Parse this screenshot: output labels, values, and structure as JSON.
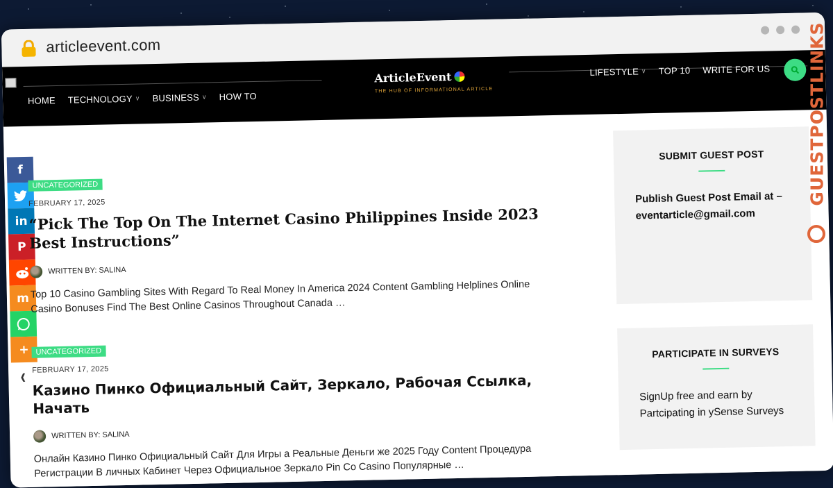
{
  "browser": {
    "url": "articleevent.com"
  },
  "header": {
    "nav_left": [
      {
        "label": "HOME",
        "dropdown": false
      },
      {
        "label": "TECHNOLOGY",
        "dropdown": true
      },
      {
        "label": "BUSINESS",
        "dropdown": true
      },
      {
        "label": "HOW TO",
        "dropdown": false
      }
    ],
    "logo": {
      "title": "ArticleEvent",
      "tagline": "THE HUB OF INFORMATIONAL ARTICLE"
    },
    "nav_right": [
      {
        "label": "LIFESTYLE",
        "dropdown": true
      },
      {
        "label": "TOP 10",
        "dropdown": false
      },
      {
        "label": "WRITE FOR US",
        "dropdown": false
      }
    ]
  },
  "social_share": [
    "facebook-icon",
    "twitter-icon",
    "linkedin-icon",
    "pinterest-icon",
    "reddit-icon",
    "mix-icon",
    "whatsapp-icon",
    "more-icon"
  ],
  "posts": [
    {
      "category": "UNCATEGORIZED",
      "date": "FEBRUARY 17, 2025",
      "title": "“Pick The Top On The Internet Casino Philippines Inside 2023 Best Instructions”",
      "author_label": "WRITTEN BY: SALINA",
      "excerpt": "Top 10 Casino Gambling Sites With Regard To Real Money In America 2024 Content Gambling Helplines Online Casino Bonuses Find The Best Online Casinos Throughout Canada …"
    },
    {
      "category": "UNCATEGORIZED",
      "date": "FEBRUARY 17, 2025",
      "title": "Казино Пинко Официальный Сайт, Зеркало, Рабочая Ссылка, Начать",
      "author_label": "WRITTEN BY: SALINA",
      "excerpt": "Онлайн Казино Пинко Официальный Сайт Для Игры а Реальные Деньги же 2025 Году Content Процедура Регистрации В личных Кабинет Через Официальное Зеркало Pin Co Casino Популярные …"
    }
  ],
  "sidebar": {
    "widgets": [
      {
        "title": "SUBMIT GUEST POST",
        "body": "Publish Guest Post Email at – eventarticle@gmail.com"
      },
      {
        "title": "PARTICIPATE IN SURVEYS",
        "body": "SignUp free and earn by Partcipating in ySense Surveys"
      }
    ]
  },
  "watermark": {
    "text": "GUESTPOSTLINKS"
  },
  "colors": {
    "accent": "#3ddc84",
    "header_bg": "#000000",
    "tagline": "#e3a73a",
    "watermark": "#e0663a"
  }
}
